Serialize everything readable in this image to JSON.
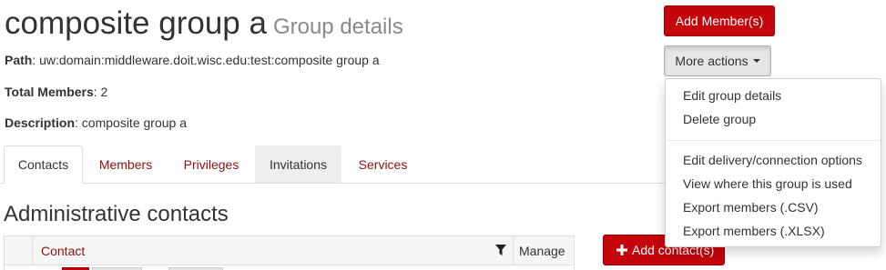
{
  "group": {
    "name": "composite group a",
    "subtitle": "Group details",
    "path_label": "Path",
    "path_value": ": uw:domain:middleware.doit.wisc.edu:test:composite group a",
    "total_label": "Total Members",
    "total_value": ": 2",
    "description_label": "Description",
    "description_value": ": composite group a"
  },
  "actions": {
    "add_members_label": "Add Member(s)",
    "more_actions_label": "More actions",
    "menu": [
      "Edit group details",
      "Delete group",
      "Edit delivery/connection options",
      "View where this group is used",
      "Export members (.CSV)",
      "Export members (.XLSX)"
    ]
  },
  "tabs": [
    "Contacts",
    "Members",
    "Privileges",
    "Invitations",
    "Services"
  ],
  "active_tab": "Contacts",
  "contacts": {
    "title": "Administrative contacts",
    "columns": [
      "Contact",
      "Manage"
    ],
    "add_contact_label": "Add contact(s)"
  },
  "colors": {
    "brand_red": "#c5050c",
    "link_red": "#8b1111"
  },
  "icons": {
    "filter": "filter-icon",
    "plus": "plus-icon",
    "caret": "caret-down-icon"
  }
}
